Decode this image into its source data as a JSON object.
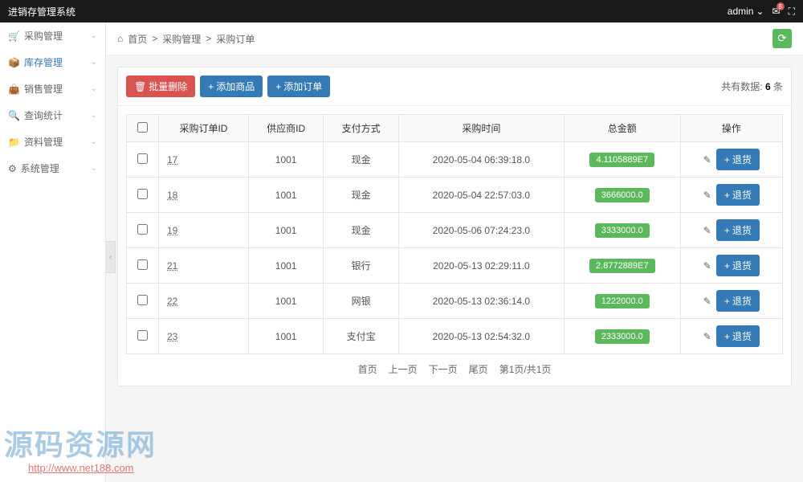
{
  "app": {
    "title": "进销存管理系统"
  },
  "user": {
    "name": "admin",
    "notif_count": "8"
  },
  "sidebar": {
    "items": [
      {
        "icon": "🛒",
        "label": "采购管理"
      },
      {
        "icon": "📦",
        "label": "库存管理"
      },
      {
        "icon": "👜",
        "label": "销售管理"
      },
      {
        "icon": "🔍",
        "label": "查询统计"
      },
      {
        "icon": "📁",
        "label": "资料管理"
      },
      {
        "icon": "⚙",
        "label": "系统管理"
      }
    ]
  },
  "breadcrumb": {
    "home": "首页",
    "sep": ">",
    "level1": "采购管理",
    "level2": "采购订单"
  },
  "toolbar": {
    "bulk_delete": "批量删除",
    "add_product": "添加商品",
    "add_order": "添加订单"
  },
  "count": {
    "prefix": "共有数据:",
    "value": "6",
    "suffix": " 条"
  },
  "table": {
    "headers": {
      "order_id": "采购订单ID",
      "supplier_id": "供应商ID",
      "pay_method": "支付方式",
      "time": "采购时间",
      "amount": "总金额",
      "action": "操作"
    },
    "rows": [
      {
        "order_id": "17",
        "supplier_id": "1001",
        "pay_method": "现金",
        "time": "2020-05-04 06:39:18.0",
        "amount": "4.1105889E7"
      },
      {
        "order_id": "18",
        "supplier_id": "1001",
        "pay_method": "现金",
        "time": "2020-05-04 22:57:03.0",
        "amount": "3666000.0"
      },
      {
        "order_id": "19",
        "supplier_id": "1001",
        "pay_method": "现金",
        "time": "2020-05-06 07:24:23.0",
        "amount": "3333000.0"
      },
      {
        "order_id": "21",
        "supplier_id": "1001",
        "pay_method": "银行",
        "time": "2020-05-13 02:29:11.0",
        "amount": "2.8772889E7"
      },
      {
        "order_id": "22",
        "supplier_id": "1001",
        "pay_method": "网银",
        "time": "2020-05-13 02:36:14.0",
        "amount": "1222000.0"
      },
      {
        "order_id": "23",
        "supplier_id": "1001",
        "pay_method": "支付宝",
        "time": "2020-05-13 02:54:32.0",
        "amount": "2333000.0"
      }
    ],
    "action_label": "退货"
  },
  "pagination": {
    "first": "首页",
    "prev": "上一页",
    "next": "下一页",
    "last": "尾页",
    "info": "第1页/共1页"
  },
  "watermark": {
    "cn": "源码资源网",
    "url": "http://www.net188.com"
  }
}
